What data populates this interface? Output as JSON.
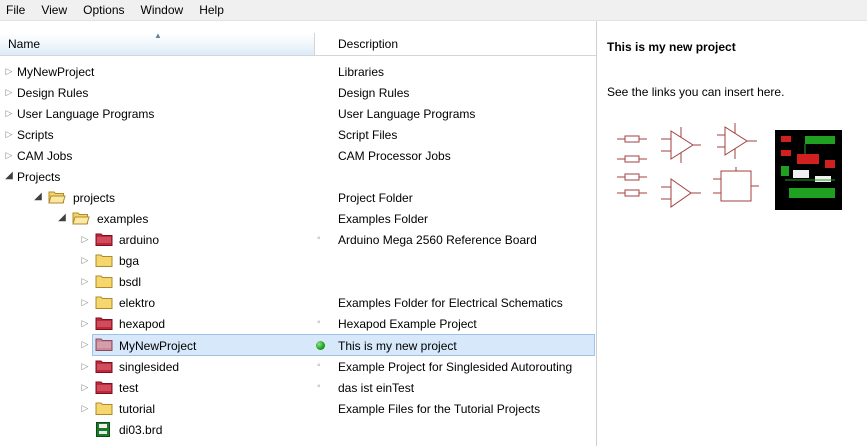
{
  "menubar": {
    "items": [
      "File",
      "View",
      "Options",
      "Window",
      "Help"
    ]
  },
  "tree": {
    "columns": {
      "name": "Name",
      "description": "Description"
    },
    "rows": [
      {
        "name": "MyNewProject",
        "desc": "Libraries"
      },
      {
        "name": "Design Rules",
        "desc": "Design Rules"
      },
      {
        "name": "User Language Programs",
        "desc": "User Language Programs"
      },
      {
        "name": "Scripts",
        "desc": "Script Files"
      },
      {
        "name": "CAM Jobs",
        "desc": "CAM Processor Jobs"
      },
      {
        "name": "Projects",
        "desc": ""
      },
      {
        "name": "projects",
        "desc": "Project Folder"
      },
      {
        "name": "examples",
        "desc": "Examples Folder"
      },
      {
        "name": "arduino",
        "desc": "Arduino Mega 2560 Reference Board"
      },
      {
        "name": "bga",
        "desc": ""
      },
      {
        "name": "bsdl",
        "desc": ""
      },
      {
        "name": "elektro",
        "desc": "Examples Folder for Electrical Schematics"
      },
      {
        "name": "hexapod",
        "desc": "Hexapod Example Project"
      },
      {
        "name": "MyNewProject",
        "desc": "This is my new project"
      },
      {
        "name": "singlesided",
        "desc": "Example Project for Singlesided Autorouting"
      },
      {
        "name": "test",
        "desc": "das ist einTest"
      },
      {
        "name": "tutorial",
        "desc": "Example Files for the Tutorial Projects"
      },
      {
        "name": "di03.brd",
        "desc": ""
      }
    ]
  },
  "info": {
    "title": "This is my new project",
    "text": "See the links you can insert here."
  },
  "colors": {
    "selection": "#d6e8fa",
    "folder_yellow": "#f5d76e",
    "folder_project": "#c0283a",
    "active_dot": "#18a018"
  }
}
